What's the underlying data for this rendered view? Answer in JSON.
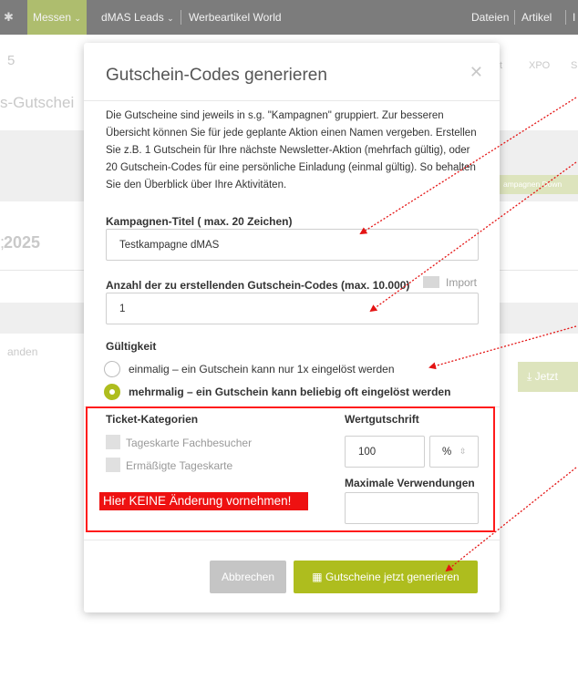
{
  "topbar": {
    "nav_messen": "Messen",
    "nav_dmas_leads": "dMAS Leads",
    "nav_werbeartikel": "Werbeartikel World",
    "nav_dateien": "Dateien",
    "nav_artikel": "Artikel",
    "nav_cut": "I",
    "icon_left": "gear-icon",
    "colors": {
      "bar": "#7c7c7c",
      "active": "#aebd6e"
    }
  },
  "background": {
    "left_num": "5",
    "left_title": "s-Gutschei",
    "year": "2025",
    "anden": "anden",
    "right_t": "t",
    "right_xpo": "XPO",
    "right_s": "S",
    "kampagnen_btn": "ampagnen Down",
    "jetzt_btn": "Jetzt"
  },
  "modal": {
    "title": "Gutschein-Codes generieren",
    "close_icon": "close-icon",
    "description": "Die Gutscheine sind jeweils in s.g. \"Kampagnen\" gruppiert. Zur besseren Übersicht können Sie für jede geplante Aktion einen Namen vergeben. Erstellen Sie z.B. 1 Gutschein für Ihre nächste Newsletter-Aktion (mehrfach gültig), oder 20 Gutschein-Codes für eine persönliche Einladung (einmal gültig). So behalten Sie den Überblick über Ihre Aktivitäten.",
    "campaign_title_label": "Kampagnen-Titel ( max. 20 Zeichen)",
    "campaign_title_value": "Testkampagne dMAS",
    "count_label": "Anzahl der zu erstellenden Gutschein-Codes (max. 10.000)",
    "import_label": "Import",
    "count_value": "1",
    "validity_label": "Gültigkeit",
    "validity_options": [
      {
        "label": "einmalig – ein Gutschein kann nur 1x eingelöst werden",
        "selected": false
      },
      {
        "label": "mehrmalig – ein Gutschein kann beliebig oft eingelöst werden",
        "selected": true
      }
    ],
    "ticket_categories_label": "Ticket-Kategorien",
    "ticket_categories": [
      "Tageskarte Fachbesucher",
      "Ermäßigte Tageskarte"
    ],
    "value_credit_label": "Wertgutschrift",
    "value_credit_value": "100",
    "unit_value": "%",
    "max_uses_label": "Maximale Verwendungen",
    "max_uses_value": "",
    "cancel_label": "Abbrechen",
    "generate_label": "Gutscheine jetzt generieren",
    "generate_icon": "barcode-icon",
    "colors": {
      "accent": "#aebd1e",
      "cancel": "#c5c5c5"
    }
  },
  "annotation": {
    "warning_text": "Hier KEINE Änderung vornehmen!",
    "colors": {
      "red": "#ff1a1a"
    }
  }
}
